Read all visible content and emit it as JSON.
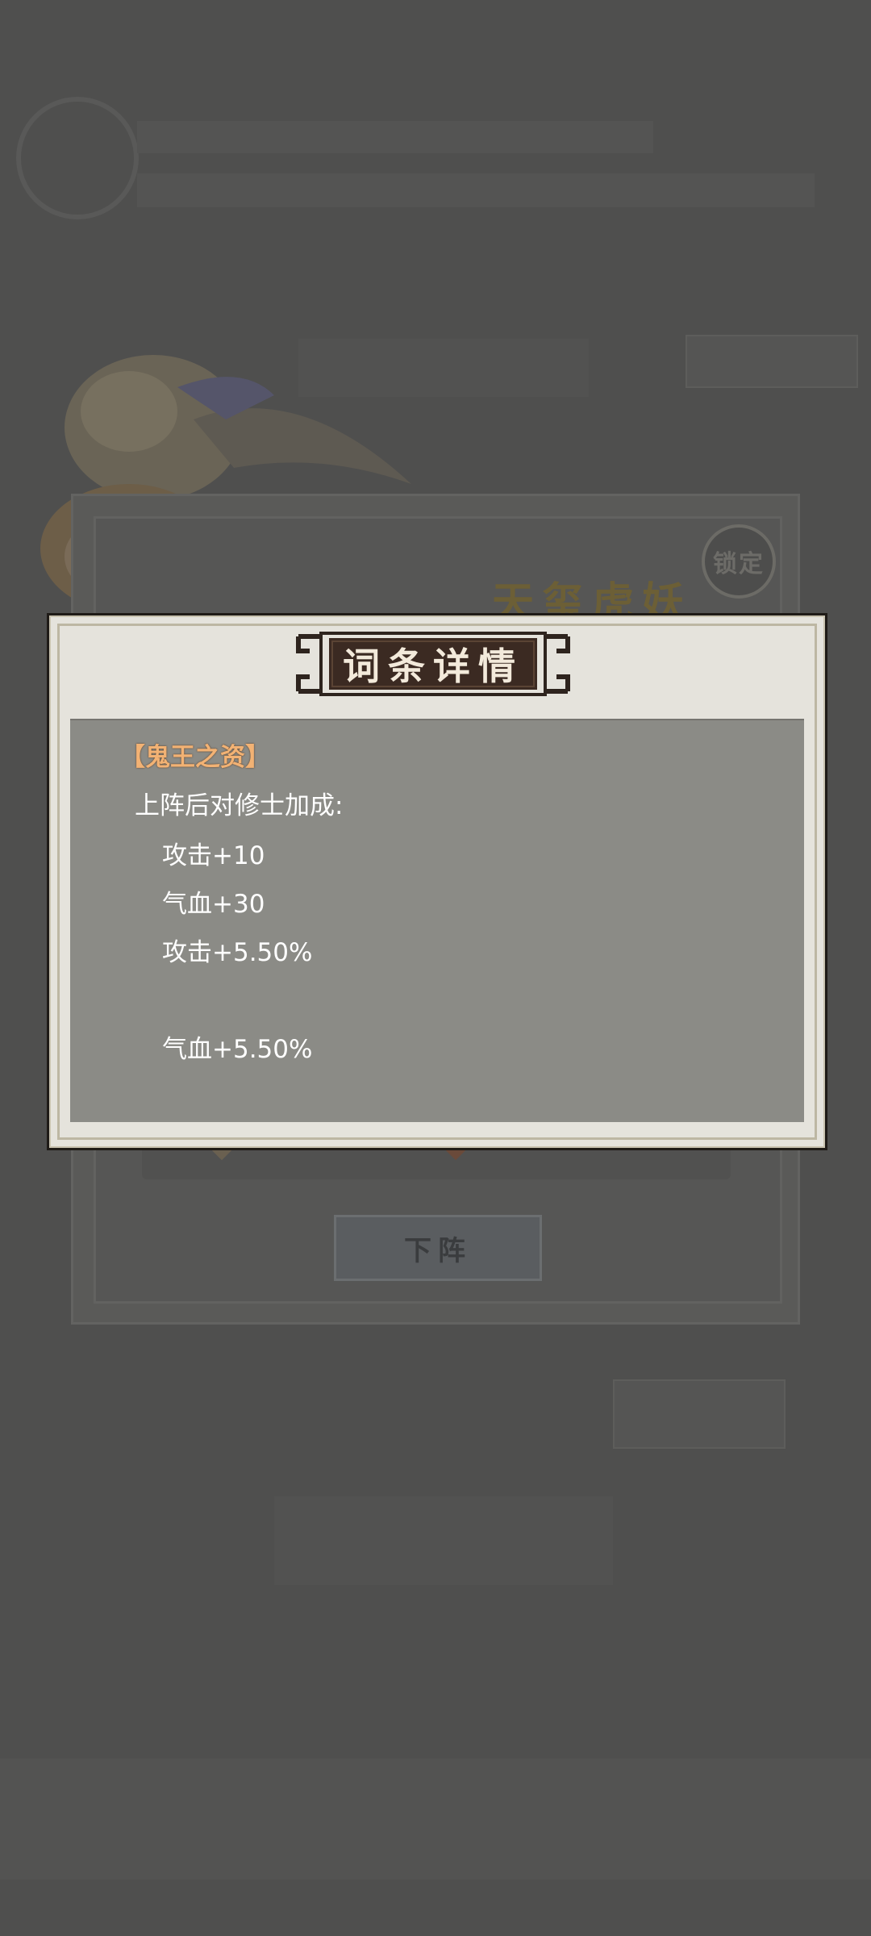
{
  "background": {
    "lock_label": "锁定",
    "pet_name": "天玺虎妖",
    "unequip_label": "下阵"
  },
  "modal": {
    "title": "词条详情",
    "affix_name": "【鬼王之资】",
    "description": "上阵后对修士加成:",
    "bonuses": [
      "攻击+10",
      "气血+30",
      "攻击+5.50%",
      "气血+5.50%"
    ]
  },
  "colors": {
    "overlay": "#4f4f4e",
    "modal_bg": "#e5e3dc",
    "content_bg": "#8b8b86",
    "affix_name": "#f2b274",
    "plaque": "#3b2a22"
  }
}
